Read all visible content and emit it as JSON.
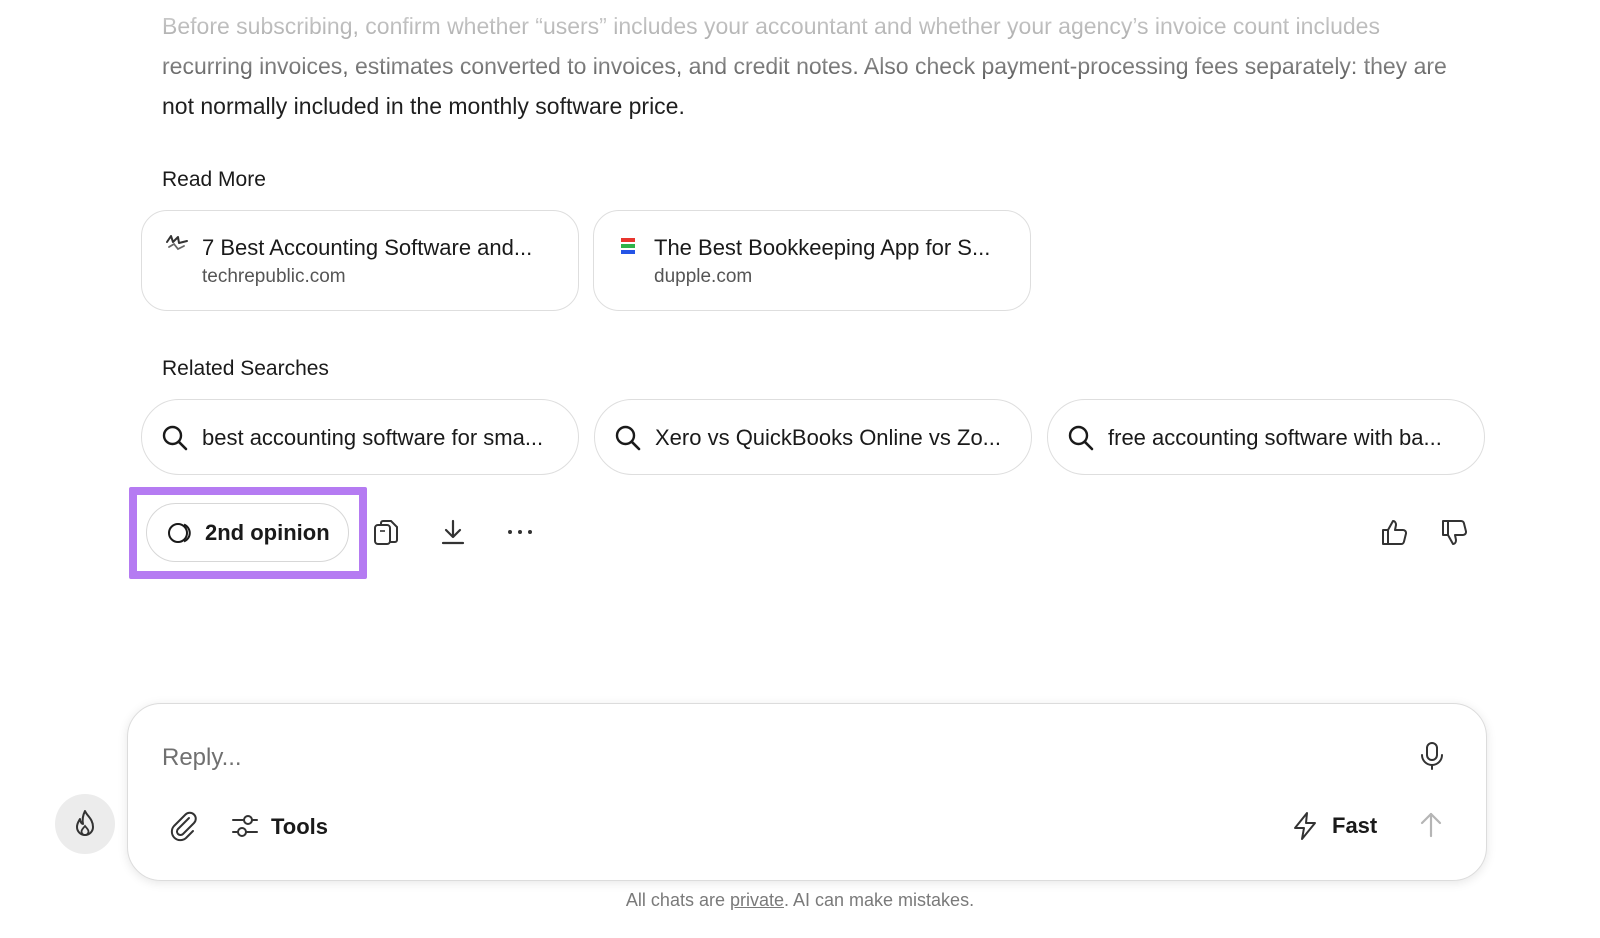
{
  "answer": {
    "paragraph": "Before subscribing, confirm whether “users” includes your accountant and whether your agency’s invoice count includes recurring invoices, estimates converted to invoices, and credit notes. Also check payment-processing fees separately: they are not normally included in the monthly software price."
  },
  "read_more": {
    "title": "Read More",
    "items": [
      {
        "title": "7 Best Accounting Software and...",
        "domain": "techrepublic.com",
        "icon": "techrepublic-favicon"
      },
      {
        "title": "The Best Bookkeeping App for S...",
        "domain": "dupple.com",
        "icon": "dupple-favicon"
      }
    ]
  },
  "related_searches": {
    "title": "Related Searches",
    "items": [
      {
        "label": "best accounting software for sma...",
        "icon": "search-icon"
      },
      {
        "label": "Xero vs QuickBooks Online vs Zo...",
        "icon": "search-icon"
      },
      {
        "label": "free accounting software with ba...",
        "icon": "search-icon"
      }
    ]
  },
  "actions": {
    "second_opinion_label": "2nd opinion",
    "icons": [
      "second-opinion-icon",
      "copy-icon",
      "download-icon",
      "more-icon",
      "thumbs-up-icon",
      "thumbs-down-icon"
    ]
  },
  "composer": {
    "placeholder": "Reply...",
    "tools_label": "Tools",
    "mode_label": "Fast",
    "icons": [
      "microphone-icon",
      "paperclip-icon",
      "tools-icon",
      "lightning-icon",
      "send-arrow-icon",
      "flame-icon"
    ]
  },
  "footer": {
    "prefix": "All chats are ",
    "link": "private",
    "suffix": ". AI can make mistakes."
  },
  "colors": {
    "highlight": "#b57bf2",
    "border": "#dedede",
    "text": "#1a1a1a",
    "muted": "#7a7a7a"
  }
}
